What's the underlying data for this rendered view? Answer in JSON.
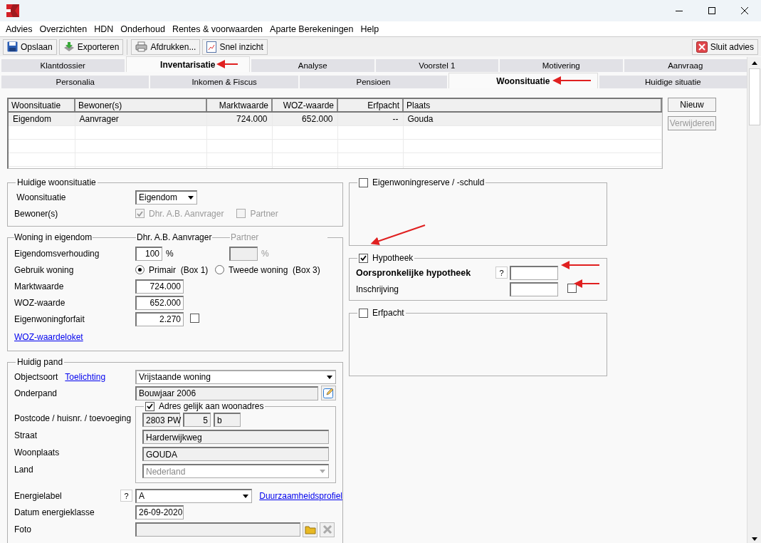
{
  "menu": [
    "Advies",
    "Overzichten",
    "HDN",
    "Onderhoud",
    "Rentes & voorwaarden",
    "Aparte Berekeningen",
    "Help"
  ],
  "toolbar": [
    {
      "label": "Opslaan",
      "kind": "save"
    },
    {
      "label": "Exporteren",
      "kind": "export"
    },
    {
      "label": "Afdrukken...",
      "kind": "print"
    },
    {
      "label": "Snel inzicht",
      "kind": "report"
    }
  ],
  "close_button": {
    "label": "Sluit advies"
  },
  "tabs": [
    {
      "label": "Klantdossier",
      "selected": false
    },
    {
      "label": "Inventarisatie",
      "selected": true
    },
    {
      "label": "Analyse",
      "selected": false
    },
    {
      "label": "Voorstel 1",
      "selected": false
    },
    {
      "label": "Motivering",
      "selected": false
    },
    {
      "label": "Aanvraag",
      "selected": false
    }
  ],
  "subtabs": [
    {
      "label": "Personalia",
      "selected": false
    },
    {
      "label": "Inkomen & Fiscus",
      "selected": false
    },
    {
      "label": "Pensioen",
      "selected": false
    },
    {
      "label": "Woonsituatie",
      "selected": true
    },
    {
      "label": "Huidige situatie",
      "selected": false
    }
  ],
  "table": {
    "columns": [
      {
        "label": "Woonsituatie",
        "kind": "text"
      },
      {
        "label": "Bewoner(s)",
        "kind": "text"
      },
      {
        "label": "Marktwaarde",
        "kind": "number"
      },
      {
        "label": "WOZ-waarde",
        "kind": "number"
      },
      {
        "label": "Erfpacht",
        "kind": "number"
      },
      {
        "label": "Plaats",
        "kind": "text"
      }
    ],
    "rows": [
      {
        "cells": [
          "Eigendom",
          "Aanvrager",
          "724.000",
          "652.000",
          "--",
          "Gouda"
        ],
        "selected": true
      }
    ]
  },
  "table_buttons": [
    {
      "label": "Nieuw",
      "disabled": false
    },
    {
      "label": "Verwijderen",
      "disabled": true
    }
  ],
  "current_situation": {
    "title": "Huidige woonsituatie",
    "situation_label": "Woonsituatie",
    "situation_value": "Eigendom",
    "residents_label": "Bewoner(s)",
    "residents": [
      {
        "label": "Dhr. A.B. Aanvrager",
        "checked": true,
        "disabled": true
      },
      {
        "label": "Partner",
        "checked": false,
        "disabled": true
      }
    ]
  },
  "owned_home": {
    "title": "Woning in eigendom",
    "col_applicant": "Dhr. A.B. Aanvrager",
    "col_partner": "Partner",
    "ownership_label": "Eigendomsverhouding",
    "ownership_value": "100",
    "ownership_unit": "%",
    "partner_unit": "%",
    "usage_label": "Gebruik woning",
    "usage_options": [
      {
        "label": "Primair  (Box 1)",
        "selected": true
      },
      {
        "label": "Tweede woning  (Box 3)",
        "selected": false
      }
    ],
    "market_label": "Marktwaarde",
    "market_value": "724.000",
    "woz_label": "WOZ-waarde",
    "woz_value": "652.000",
    "forfait_label": "Eigenwoningforfait",
    "forfait_value": "2.270",
    "forfait_checked": false,
    "link": "WOZ-waardeloket"
  },
  "property": {
    "title": "Huidig pand",
    "object_label": "Objectsoort",
    "object_link": "Toelichting",
    "object_value": "Vrijstaande woning",
    "collateral_label": "Onderpand",
    "collateral_value": "Bouwjaar 2006",
    "address_same": {
      "label": "Adres gelijk aan woonadres",
      "checked": true
    },
    "postcode_label": "Postcode / huisnr. / toevoeging",
    "postcode": "2803 PW",
    "number": "5",
    "suffix": "b",
    "street_label": "Straat",
    "street": "Harderwijkweg",
    "city_label": "Woonplaats",
    "city": "GOUDA",
    "country_label": "Land",
    "country": "Nederland",
    "energy_label": "Energielabel",
    "energy_help": "?",
    "energy_value": "A",
    "energy_link": "Duurzaamheidsprofiel",
    "energy_date_label": "Datum energieklasse",
    "energy_date": "26-09-2020",
    "photo_label": "Foto"
  },
  "reserve": {
    "label": "Eigenwoningreserve / -schuld",
    "checked": false
  },
  "mortgage": {
    "label": "Hypotheek",
    "checked": true,
    "original_label": "Oorspronkelijke hypotheek",
    "help": "?",
    "registration_label": "Inschrijving",
    "registration_checked": false
  },
  "leasehold": {
    "label": "Erfpacht",
    "checked": false
  }
}
